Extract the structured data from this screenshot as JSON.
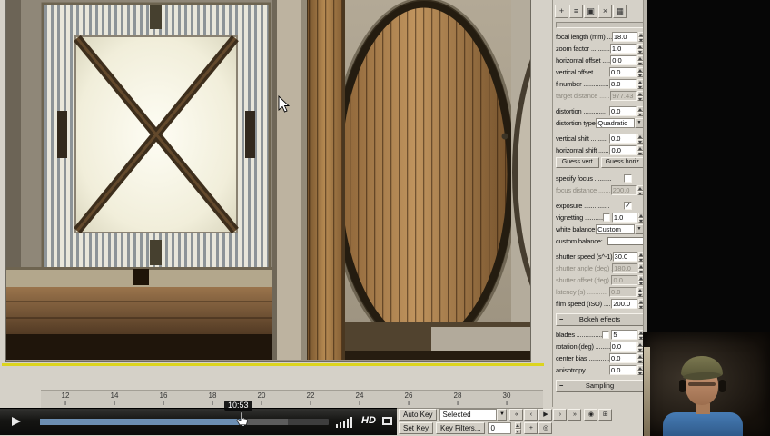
{
  "colors": {
    "ui_gray": "#d5d1c8",
    "accent_yellow": "#dcd41e",
    "progress_blue": "#6d8fb3",
    "player_bar": "#141413"
  },
  "player": {
    "seek_tooltip": "10:53",
    "hd_label": "HD",
    "progress_played_pct": 70,
    "progress_loaded_pct": 86
  },
  "timeline": {
    "ticks": [
      "12",
      "14",
      "16",
      "18",
      "20",
      "22",
      "24",
      "26",
      "28",
      "30"
    ]
  },
  "statusbar": {
    "auto_key": "Auto Key",
    "selected": "Selected",
    "set_key": "Set Key",
    "key_filters": "Key Filters...",
    "frame_field": "0",
    "transport": [
      {
        "name": "go-to-start-button",
        "glyph": "«"
      },
      {
        "name": "previous-frame-button",
        "glyph": "‹"
      },
      {
        "name": "play-animation-button",
        "glyph": "▶"
      },
      {
        "name": "next-frame-button",
        "glyph": "›"
      },
      {
        "name": "go-to-end-button",
        "glyph": "»"
      }
    ],
    "row1_icons": [
      {
        "name": "zoom-extents-button",
        "glyph": "◉"
      },
      {
        "name": "field-of-view-button",
        "glyph": "⊞"
      }
    ],
    "row2_icons": [
      {
        "name": "pan-view-button",
        "glyph": "+"
      },
      {
        "name": "orbit-view-button",
        "glyph": "◎"
      }
    ]
  },
  "panel": {
    "toolbar": [
      {
        "name": "pin-stack-icon",
        "glyph": "+"
      },
      {
        "name": "show-end-result-icon",
        "glyph": "≡"
      },
      {
        "name": "make-unique-icon",
        "glyph": "▣"
      },
      {
        "name": "remove-modifier-icon",
        "glyph": "×"
      },
      {
        "name": "configure-modifier-sets-icon",
        "glyph": "▦"
      }
    ],
    "rows": [
      {
        "type": "spinner",
        "label": "focal length (mm) ......",
        "value": "18.0"
      },
      {
        "type": "spinner",
        "label": "zoom factor ............",
        "value": "1.0"
      },
      {
        "type": "spinner",
        "label": "horizontal offset ......",
        "value": "0.0"
      },
      {
        "type": "spinner",
        "label": "vertical offset ........",
        "value": "0.0"
      },
      {
        "type": "spinner",
        "label": "f-number ...............",
        "value": "8.0"
      },
      {
        "type": "spinner",
        "label": "target distance ........",
        "value": "977.43",
        "disabled": true
      },
      {
        "type": "spinner",
        "label": "distortion .............",
        "value": "0.0",
        "gap": true
      },
      {
        "type": "dropdown",
        "label": "distortion type:",
        "value": "Quadratic"
      },
      {
        "type": "spinner",
        "label": "vertical shift .........",
        "value": "0.0",
        "gap": true
      },
      {
        "type": "spinner",
        "label": "horizontal shift .......",
        "value": "0.0"
      },
      {
        "type": "buttons",
        "buttons": [
          {
            "name": "guess-vert-button",
            "label": "Guess vert"
          },
          {
            "name": "guess-horiz-button",
            "label": "Guess horiz"
          }
        ]
      },
      {
        "type": "check",
        "label": "specify focus ..........",
        "checked": false,
        "gap": true
      },
      {
        "type": "spinner",
        "label": "focus distance .........",
        "value": "200.0",
        "disabled": true
      },
      {
        "type": "check",
        "label": "exposure ...............",
        "checked": true,
        "gap": true
      },
      {
        "type": "check-spinner",
        "label": "vignetting .............",
        "checked": false,
        "value": "1.0"
      },
      {
        "type": "dropdown",
        "label": "white balance:",
        "value": "Custom"
      },
      {
        "type": "swatch",
        "label": "custom balance:",
        "swatch": "#ffffff"
      },
      {
        "type": "spinner",
        "label": "shutter speed (s^-1) ...",
        "value": "30.0",
        "gap": true
      },
      {
        "type": "spinner",
        "label": "shutter angle (deg) ....",
        "value": "180.0",
        "disabled": true
      },
      {
        "type": "spinner",
        "label": "shutter offset (deg) ...",
        "value": "0.0",
        "disabled": true
      },
      {
        "type": "spinner",
        "label": "latency (s) ............",
        "value": "0.0",
        "disabled": true
      },
      {
        "type": "spinner",
        "label": "film speed (ISO) .......",
        "value": "200.0"
      },
      {
        "type": "header",
        "label": "Bokeh effects"
      },
      {
        "type": "check-spinner",
        "label": "blades .................",
        "checked": false,
        "value": "5"
      },
      {
        "type": "spinner",
        "label": "rotation (deg) .........",
        "value": "0.0"
      },
      {
        "type": "spinner",
        "label": "center bias ............",
        "value": "0.0"
      },
      {
        "type": "spinner",
        "label": "anisotropy .............",
        "value": "0.0"
      },
      {
        "type": "header",
        "label": "Sampling"
      }
    ]
  }
}
